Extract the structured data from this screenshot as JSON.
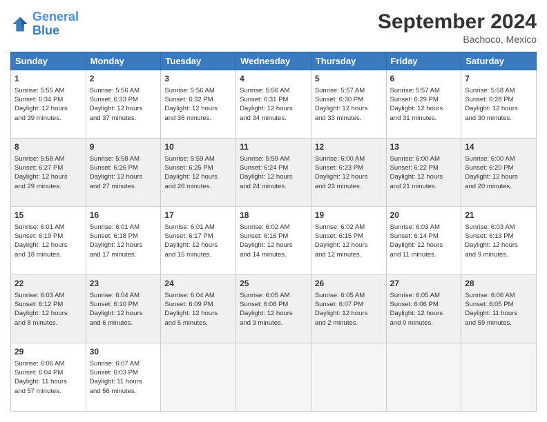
{
  "header": {
    "logo_general": "General",
    "logo_blue": "Blue",
    "month_title": "September 2024",
    "location": "Bachoco, Mexico"
  },
  "days_of_week": [
    "Sunday",
    "Monday",
    "Tuesday",
    "Wednesday",
    "Thursday",
    "Friday",
    "Saturday"
  ],
  "weeks": [
    {
      "shaded": false,
      "days": [
        {
          "num": "1",
          "lines": [
            "Sunrise: 5:55 AM",
            "Sunset: 6:34 PM",
            "Daylight: 12 hours",
            "and 39 minutes."
          ]
        },
        {
          "num": "2",
          "lines": [
            "Sunrise: 5:56 AM",
            "Sunset: 6:33 PM",
            "Daylight: 12 hours",
            "and 37 minutes."
          ]
        },
        {
          "num": "3",
          "lines": [
            "Sunrise: 5:56 AM",
            "Sunset: 6:32 PM",
            "Daylight: 12 hours",
            "and 36 minutes."
          ]
        },
        {
          "num": "4",
          "lines": [
            "Sunrise: 5:56 AM",
            "Sunset: 6:31 PM",
            "Daylight: 12 hours",
            "and 34 minutes."
          ]
        },
        {
          "num": "5",
          "lines": [
            "Sunrise: 5:57 AM",
            "Sunset: 6:30 PM",
            "Daylight: 12 hours",
            "and 33 minutes."
          ]
        },
        {
          "num": "6",
          "lines": [
            "Sunrise: 5:57 AM",
            "Sunset: 6:29 PM",
            "Daylight: 12 hours",
            "and 31 minutes."
          ]
        },
        {
          "num": "7",
          "lines": [
            "Sunrise: 5:58 AM",
            "Sunset: 6:28 PM",
            "Daylight: 12 hours",
            "and 30 minutes."
          ]
        }
      ]
    },
    {
      "shaded": true,
      "days": [
        {
          "num": "8",
          "lines": [
            "Sunrise: 5:58 AM",
            "Sunset: 6:27 PM",
            "Daylight: 12 hours",
            "and 29 minutes."
          ]
        },
        {
          "num": "9",
          "lines": [
            "Sunrise: 5:58 AM",
            "Sunset: 6:26 PM",
            "Daylight: 12 hours",
            "and 27 minutes."
          ]
        },
        {
          "num": "10",
          "lines": [
            "Sunrise: 5:59 AM",
            "Sunset: 6:25 PM",
            "Daylight: 12 hours",
            "and 26 minutes."
          ]
        },
        {
          "num": "11",
          "lines": [
            "Sunrise: 5:59 AM",
            "Sunset: 6:24 PM",
            "Daylight: 12 hours",
            "and 24 minutes."
          ]
        },
        {
          "num": "12",
          "lines": [
            "Sunrise: 6:00 AM",
            "Sunset: 6:23 PM",
            "Daylight: 12 hours",
            "and 23 minutes."
          ]
        },
        {
          "num": "13",
          "lines": [
            "Sunrise: 6:00 AM",
            "Sunset: 6:22 PM",
            "Daylight: 12 hours",
            "and 21 minutes."
          ]
        },
        {
          "num": "14",
          "lines": [
            "Sunrise: 6:00 AM",
            "Sunset: 6:20 PM",
            "Daylight: 12 hours",
            "and 20 minutes."
          ]
        }
      ]
    },
    {
      "shaded": false,
      "days": [
        {
          "num": "15",
          "lines": [
            "Sunrise: 6:01 AM",
            "Sunset: 6:19 PM",
            "Daylight: 12 hours",
            "and 18 minutes."
          ]
        },
        {
          "num": "16",
          "lines": [
            "Sunrise: 6:01 AM",
            "Sunset: 6:18 PM",
            "Daylight: 12 hours",
            "and 17 minutes."
          ]
        },
        {
          "num": "17",
          "lines": [
            "Sunrise: 6:01 AM",
            "Sunset: 6:17 PM",
            "Daylight: 12 hours",
            "and 15 minutes."
          ]
        },
        {
          "num": "18",
          "lines": [
            "Sunrise: 6:02 AM",
            "Sunset: 6:16 PM",
            "Daylight: 12 hours",
            "and 14 minutes."
          ]
        },
        {
          "num": "19",
          "lines": [
            "Sunrise: 6:02 AM",
            "Sunset: 6:15 PM",
            "Daylight: 12 hours",
            "and 12 minutes."
          ]
        },
        {
          "num": "20",
          "lines": [
            "Sunrise: 6:03 AM",
            "Sunset: 6:14 PM",
            "Daylight: 12 hours",
            "and 11 minutes."
          ]
        },
        {
          "num": "21",
          "lines": [
            "Sunrise: 6:03 AM",
            "Sunset: 6:13 PM",
            "Daylight: 12 hours",
            "and 9 minutes."
          ]
        }
      ]
    },
    {
      "shaded": true,
      "days": [
        {
          "num": "22",
          "lines": [
            "Sunrise: 6:03 AM",
            "Sunset: 6:12 PM",
            "Daylight: 12 hours",
            "and 8 minutes."
          ]
        },
        {
          "num": "23",
          "lines": [
            "Sunrise: 6:04 AM",
            "Sunset: 6:10 PM",
            "Daylight: 12 hours",
            "and 6 minutes."
          ]
        },
        {
          "num": "24",
          "lines": [
            "Sunrise: 6:04 AM",
            "Sunset: 6:09 PM",
            "Daylight: 12 hours",
            "and 5 minutes."
          ]
        },
        {
          "num": "25",
          "lines": [
            "Sunrise: 6:05 AM",
            "Sunset: 6:08 PM",
            "Daylight: 12 hours",
            "and 3 minutes."
          ]
        },
        {
          "num": "26",
          "lines": [
            "Sunrise: 6:05 AM",
            "Sunset: 6:07 PM",
            "Daylight: 12 hours",
            "and 2 minutes."
          ]
        },
        {
          "num": "27",
          "lines": [
            "Sunrise: 6:05 AM",
            "Sunset: 6:06 PM",
            "Daylight: 12 hours",
            "and 0 minutes."
          ]
        },
        {
          "num": "28",
          "lines": [
            "Sunrise: 6:06 AM",
            "Sunset: 6:05 PM",
            "Daylight: 11 hours",
            "and 59 minutes."
          ]
        }
      ]
    },
    {
      "shaded": false,
      "days": [
        {
          "num": "29",
          "lines": [
            "Sunrise: 6:06 AM",
            "Sunset: 6:04 PM",
            "Daylight: 11 hours",
            "and 57 minutes."
          ]
        },
        {
          "num": "30",
          "lines": [
            "Sunrise: 6:07 AM",
            "Sunset: 6:03 PM",
            "Daylight: 11 hours",
            "and 56 minutes."
          ]
        },
        {
          "num": "",
          "lines": []
        },
        {
          "num": "",
          "lines": []
        },
        {
          "num": "",
          "lines": []
        },
        {
          "num": "",
          "lines": []
        },
        {
          "num": "",
          "lines": []
        }
      ]
    }
  ]
}
